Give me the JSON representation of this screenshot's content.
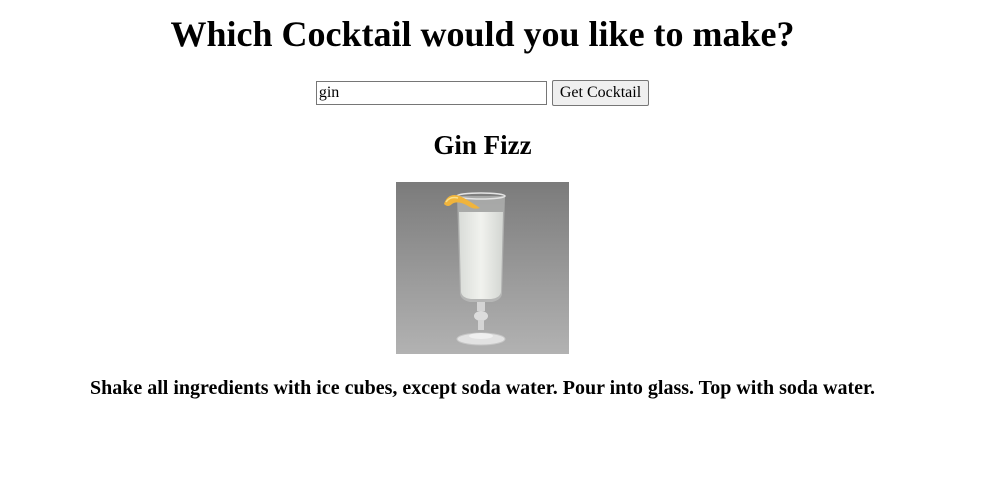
{
  "page": {
    "heading": "Which Cocktail would you like to make?"
  },
  "search": {
    "value": "gin",
    "button_label": "Get Cocktail"
  },
  "result": {
    "name": "Gin Fizz",
    "photo_icon": "cocktail-glass-photo",
    "instructions": "Shake all ingredients with ice cubes, except soda water. Pour into glass. Top with soda water."
  },
  "colors": {
    "text": "#000000",
    "background": "#ffffff",
    "button_bg": "#efefef",
    "border": "#767676",
    "photo_bg": "#8e8e8e",
    "lemon": "#f0b43c"
  }
}
